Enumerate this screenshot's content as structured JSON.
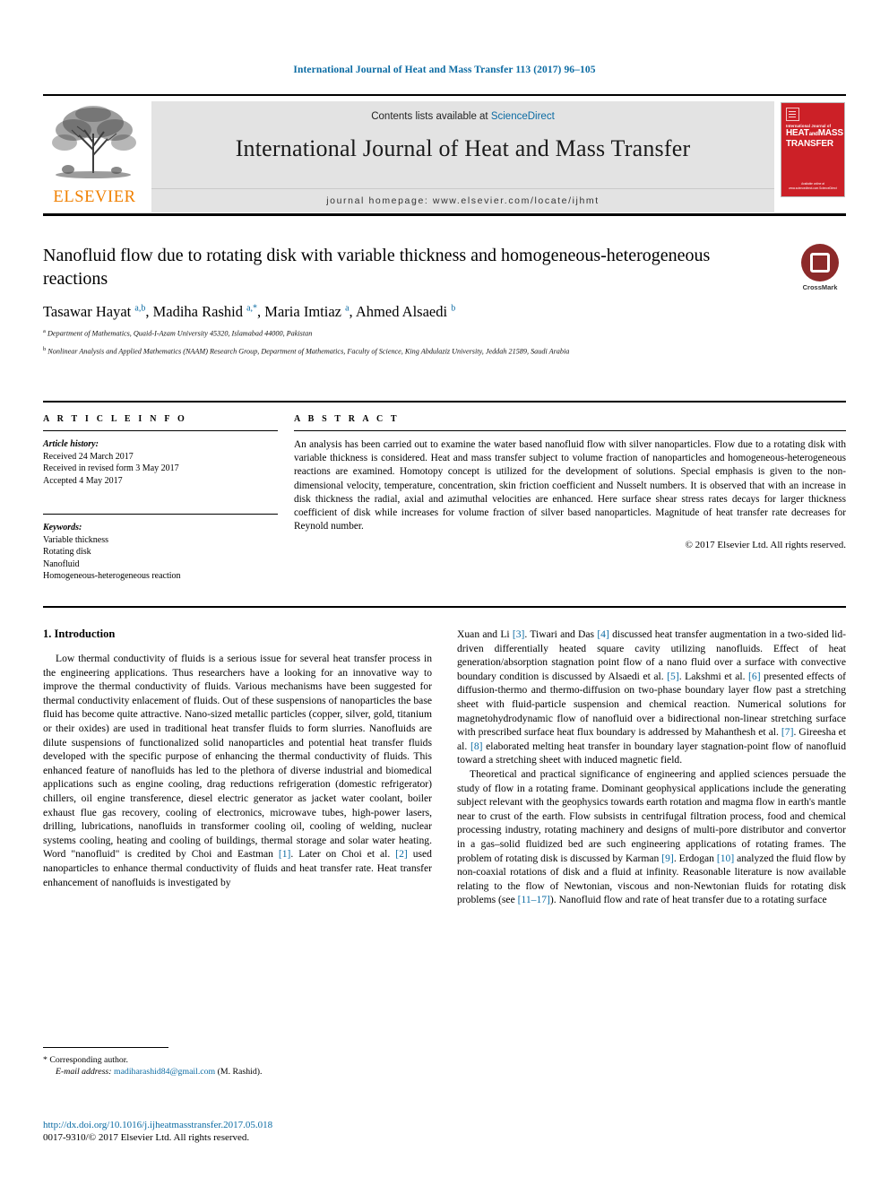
{
  "running_head": "International Journal of Heat and Mass Transfer 113 (2017) 96–105",
  "masthead": {
    "contents_prefix": "Contents lists available at ",
    "sciencedirect": "ScienceDirect",
    "journal_title": "International Journal of Heat and Mass Transfer",
    "homepage": "journal homepage: www.elsevier.com/locate/ijhmt",
    "publisher": "ELSEVIER",
    "cover": {
      "kicker": "International Journal of",
      "line1": "HEAT",
      "and": "and",
      "line1b": "MASS",
      "line2": "TRANSFER",
      "footer": "Available online at www.sciencedirect.com\nScienceDirect"
    }
  },
  "crossmark": {
    "label": "CrossMark"
  },
  "article": {
    "title": "Nanofluid flow due to rotating disk with variable thickness and homogeneous-heterogeneous reactions",
    "authors_html": "Tasawar Hayat <sup>a,b</sup>, Madiha Rashid <sup>a,*</sup>, Maria Imtiaz <sup>a</sup>, Ahmed Alsaedi <sup>b</sup>",
    "affiliation_a": "Department of Mathematics, Quaid-I-Azam University 45320, Islamabad 44000, Pakistan",
    "affiliation_b": "Nonlinear Analysis and Applied Mathematics (NAAM) Research Group, Department of Mathematics, Faculty of Science, King Abdulaziz University, Jeddah 21589, Saudi Arabia"
  },
  "article_info": {
    "heading": "A R T I C L E   I N F O",
    "history_label": "Article history:",
    "received": "Received 24 March 2017",
    "revised": "Received in revised form 3 May 2017",
    "accepted": "Accepted 4 May 2017",
    "keywords_label": "Keywords:",
    "keywords": [
      "Variable thickness",
      "Rotating disk",
      "Nanofluid",
      "Homogeneous-heterogeneous reaction"
    ]
  },
  "abstract": {
    "heading": "A B S T R A C T",
    "text": "An analysis has been carried out to examine the water based nanofluid flow with silver nanoparticles. Flow due to a rotating disk with variable thickness is considered. Heat and mass transfer subject to volume fraction of nanoparticles and homogeneous-heterogeneous reactions are examined. Homotopy concept is utilized for the development of solutions. Special emphasis is given to the non-dimensional velocity, temperature, concentration, skin friction coefficient and Nusselt numbers. It is observed that with an increase in disk thickness the radial, axial and azimuthal velocities are enhanced. Here surface shear stress rates decays for larger thickness coefficient of disk while increases for volume fraction of silver based nanoparticles. Magnitude of heat transfer rate decreases for Reynold number.",
    "copyright": "© 2017 Elsevier Ltd. All rights reserved."
  },
  "introduction": {
    "heading": "1. Introduction",
    "left_paragraph": "Low thermal conductivity of fluids is a serious issue for several heat transfer process in the engineering applications. Thus researchers have a looking for an innovative way to improve the thermal conductivity of fluids. Various mechanisms have been suggested for thermal conductivity enlacement of fluids. Out of these suspensions of nanoparticles the base fluid has become quite attractive. Nano-sized metallic particles (copper, silver, gold, titanium or their oxides) are used in traditional heat transfer fluids to form slurries. Nanofluids are dilute suspensions of functionalized solid nanoparticles and potential heat transfer fluids developed with the specific purpose of enhancing the thermal conductivity of fluids. This enhanced feature of nanofluids has led to the plethora of diverse industrial and biomedical applications such as engine cooling, drag reductions refrigeration (domestic refrigerator) chillers, oil engine transference, diesel electric generator as jacket water coolant, boiler exhaust flue gas recovery, cooling of electronics, microwave tubes, high-power lasers, drilling, lubrications, nanofluids in transformer cooling oil, cooling of welding, nuclear systems cooling, heating and cooling of buildings, thermal storage and solar water heating. Word \"nanofluid\" is credited by Choi and Eastman [1]. Later on Choi et al. [2] used nanoparticles to enhance thermal conductivity of fluids and heat transfer rate. Heat transfer enhancement of nanofluids is investigated by",
    "right_paragraph_1": "Xuan and Li [3]. Tiwari and Das [4] discussed heat transfer augmentation in a two-sided lid-driven differentially heated square cavity utilizing nanofluids. Effect of heat generation/absorption stagnation point flow of a nano fluid over a surface with convective boundary condition is discussed by Alsaedi et al. [5]. Lakshmi et al. [6] presented effects of diffusion-thermo and thermo-diffusion on two-phase boundary layer flow past a stretching sheet with fluid-particle suspension and chemical reaction. Numerical solutions for magnetohydrodynamic flow of nanofluid over a bidirectional non-linear stretching surface with prescribed surface heat flux boundary is addressed by Mahanthesh et al. [7]. Gireesha et al. [8] elaborated melting heat transfer in boundary layer stagnation-point flow of nanofluid toward a stretching sheet with induced magnetic field.",
    "right_paragraph_2": "Theoretical and practical significance of engineering and applied sciences persuade the study of flow in a rotating frame. Dominant geophysical applications include the generating subject relevant with the geophysics towards earth rotation and magma flow in earth's mantle near to crust of the earth. Flow subsists in centrifugal filtration process, food and chemical processing industry, rotating machinery and designs of multi-pore distributor and convertor in a gas–solid fluidized bed are such engineering applications of rotating frames. The problem of rotating disk is discussed by Karman [9]. Erdogan [10] analyzed the fluid flow by non-coaxial rotations of disk and a fluid at infinity. Reasonable literature is now available relating to the flow of Newtonian, viscous and non-Newtonian fluids for rotating disk problems (see [11–17]). Nanofluid flow and rate of heat transfer due to a rotating surface"
  },
  "footnotes": {
    "corresponding_marker": "*",
    "corresponding_text": "Corresponding author.",
    "email_label": "E-mail address:",
    "email": "madiharashid84@gmail.com",
    "email_owner": "(M. Rashid).",
    "doi": "http://dx.doi.org/10.1016/j.ijheatmasstransfer.2017.05.018",
    "issn_line": "0017-9310/© 2017 Elsevier Ltd. All rights reserved."
  },
  "colors": {
    "link": "#0b6ba3",
    "elsevier_orange": "#f08000",
    "cover_red": "#cc2027",
    "masthead_gray": "#e3e3e3"
  }
}
